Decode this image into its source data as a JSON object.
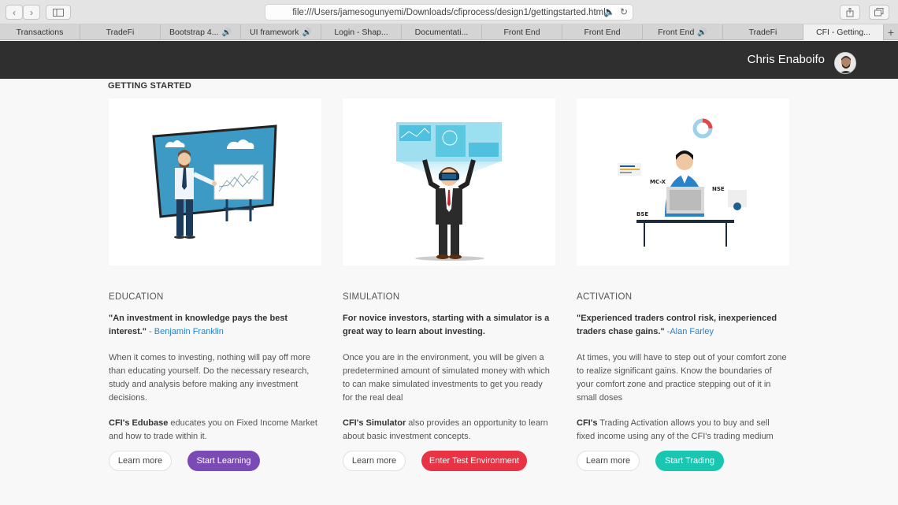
{
  "browser": {
    "url": "file:///Users/jamesogunyemi/Downloads/cfiprocess/design1/gettingstarted.html",
    "tabs": [
      {
        "label": "Transactions",
        "audio": false
      },
      {
        "label": "TradeFi",
        "audio": false
      },
      {
        "label": "Bootstrap 4...",
        "audio": true
      },
      {
        "label": "UI framework",
        "audio": true
      },
      {
        "label": "Login - Shap...",
        "audio": false
      },
      {
        "label": "Documentati...",
        "audio": false
      },
      {
        "label": "Front End",
        "audio": false
      },
      {
        "label": "Front End",
        "audio": false
      },
      {
        "label": "Front End",
        "audio": true
      },
      {
        "label": "TradeFi",
        "audio": false
      },
      {
        "label": "CFI - Getting...",
        "audio": false
      }
    ],
    "new_tab": "+"
  },
  "header": {
    "username": "Chris Enaboifo"
  },
  "page": {
    "title": "GETTING STARTED"
  },
  "cards": [
    {
      "category": "EDUCATION",
      "quote": "\"An investment in knowledge pays the best interest.\"",
      "author": "- Benjamin Franklin",
      "body": "When it comes to investing, nothing will pay off more than educating yourself. Do the necessary research, study and analysis before making any investment decisions.",
      "brand": "CFI's Edubase",
      "body2": " educates you on Fixed Income Market and how to trade within it.",
      "learn_more": "Learn more",
      "action": "Start Learning",
      "action_color": "#7b4bb5"
    },
    {
      "category": "SIMULATION",
      "quote": "For novice investors, starting with a simulator is a great way to learn about investing.",
      "author": "",
      "body": "Once you are in the environment, you will be given a predetermined amount of simulated money with which to can make simulated investments to get you ready for the real deal",
      "brand": "CFI's Simulator",
      "body2": " also provides an opportunity to learn about basic investment concepts.",
      "learn_more": "Learn more",
      "action": "Enter Test Environment",
      "action_color": "#e83344"
    },
    {
      "category": "ACTIVATION",
      "quote": "\"Experienced traders control risk, inexperienced traders chase gains.\"",
      "author": " -Alan Farley",
      "body": "At times, you will have to step out of your comfort zone to realize significant gains. Know the boundaries of your comfort zone and practice stepping out of it in small doses",
      "brand": "CFI's",
      "body2": " Trading Activation allows you to buy and sell fixed income using any of the CFI's trading medium",
      "learn_more": "Learn more",
      "action": "Start Trading",
      "action_color": "#19c6b0",
      "illustration_labels": [
        "MC-X",
        "NSE",
        "BSE"
      ]
    }
  ]
}
